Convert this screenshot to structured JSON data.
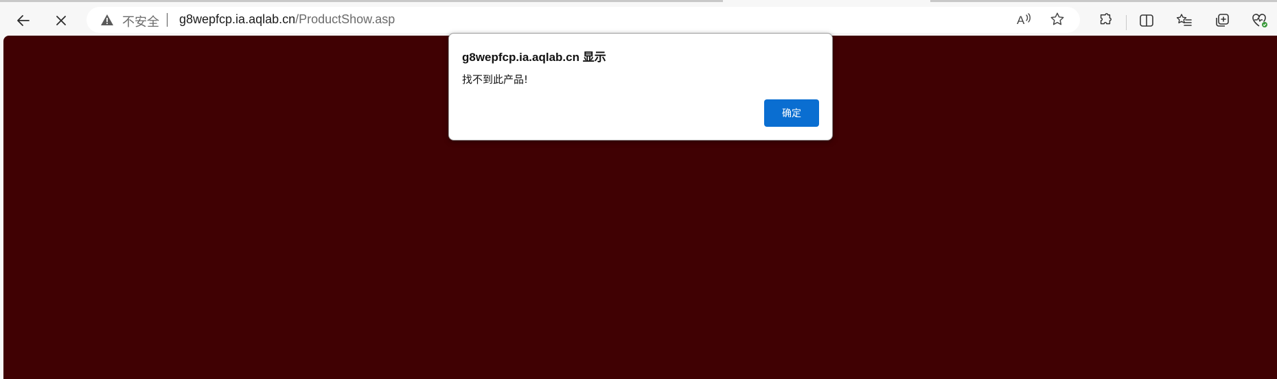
{
  "browser": {
    "security_label": "不安全",
    "url_host": "g8wepfcp.ia.aqlab.cn",
    "url_path": "/ProductShow.asp",
    "icons": {
      "back": "back-arrow-icon",
      "stop": "close-icon",
      "warning": "warning-triangle-icon",
      "read_aloud": "read-aloud-icon",
      "favorite": "star-icon",
      "extensions": "puzzle-icon",
      "split_screen": "split-screen-icon",
      "favorites": "favorites-list-icon",
      "collections": "collections-icon",
      "browser_essentials": "heart-pulse-icon"
    }
  },
  "page": {
    "background_color": "#400103"
  },
  "dialog": {
    "title": "g8wepfcp.ia.aqlab.cn 显示",
    "message": "找不到此产品!",
    "ok_label": "确定",
    "ok_color": "#0a6ed1"
  }
}
